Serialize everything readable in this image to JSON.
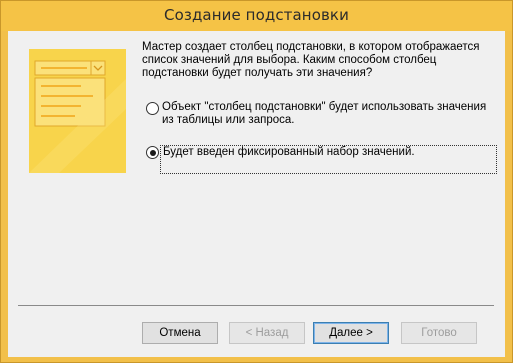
{
  "window": {
    "title": "Создание подстановки"
  },
  "wizard": {
    "intro_text": "Мастер создает столбец подстановки, в котором отображается список значений для выбора.  Каким способом столбец подстановки будет получать эти значения?",
    "options": [
      {
        "label": "Объект \"столбец подстановки\" будет использовать значения из таблицы или запроса.",
        "checked": false
      },
      {
        "label": "Будет введен фиксированный набор значений.",
        "checked": true
      }
    ]
  },
  "buttons": {
    "cancel": "Отмена",
    "back": "< Назад",
    "next": "Далее >",
    "finish": "Готово"
  },
  "colors": {
    "title_bar": "#f5c346",
    "illustration": "#f5c93c"
  }
}
